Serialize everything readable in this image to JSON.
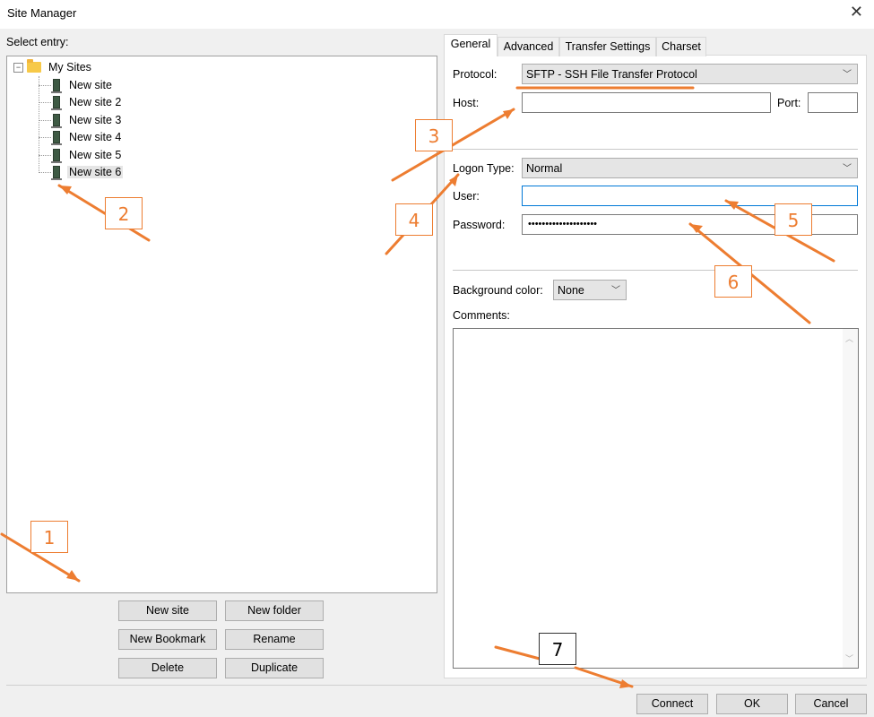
{
  "window": {
    "title": "Site Manager",
    "close_icon": "close-icon"
  },
  "left": {
    "select_entry_label": "Select entry:",
    "tree": {
      "root": {
        "label": "My Sites",
        "icon": "folder-icon",
        "expand_symbol": "⊟"
      },
      "children": [
        {
          "label": "New site"
        },
        {
          "label": "New site 2"
        },
        {
          "label": "New site 3"
        },
        {
          "label": "New site 4"
        },
        {
          "label": "New site 5"
        },
        {
          "label": "New site 6",
          "selected": true
        }
      ],
      "site_icon": "server-icon"
    },
    "buttons": {
      "new_site": "New site",
      "new_folder": "New folder",
      "new_bookmark": "New Bookmark",
      "rename": "Rename",
      "delete": "Delete",
      "duplicate": "Duplicate"
    }
  },
  "tabs": [
    {
      "label": "General",
      "active": true
    },
    {
      "label": "Advanced"
    },
    {
      "label": "Transfer Settings"
    },
    {
      "label": "Charset"
    }
  ],
  "general": {
    "protocol_label": "Protocol:",
    "protocol_value": "SFTP - SSH File Transfer Protocol",
    "host_label": "Host:",
    "host_value": "",
    "port_label": "Port:",
    "port_value": "",
    "logon_type_label": "Logon Type:",
    "logon_type_value": "Normal",
    "user_label": "User:",
    "user_value": "",
    "password_label": "Password:",
    "password_value": "••••••••••••••••••••",
    "bg_color_label": "Background color:",
    "bg_color_value": "None",
    "comments_label": "Comments:",
    "comments_value": ""
  },
  "footer": {
    "connect": "Connect",
    "ok": "OK",
    "cancel": "Cancel"
  },
  "annotations": [
    "1",
    "2",
    "3",
    "4",
    "5",
    "6",
    "7"
  ],
  "colors": {
    "annotation": "#ed7d31",
    "selection": "#e5e5e5",
    "focus_border": "#0078d7"
  }
}
